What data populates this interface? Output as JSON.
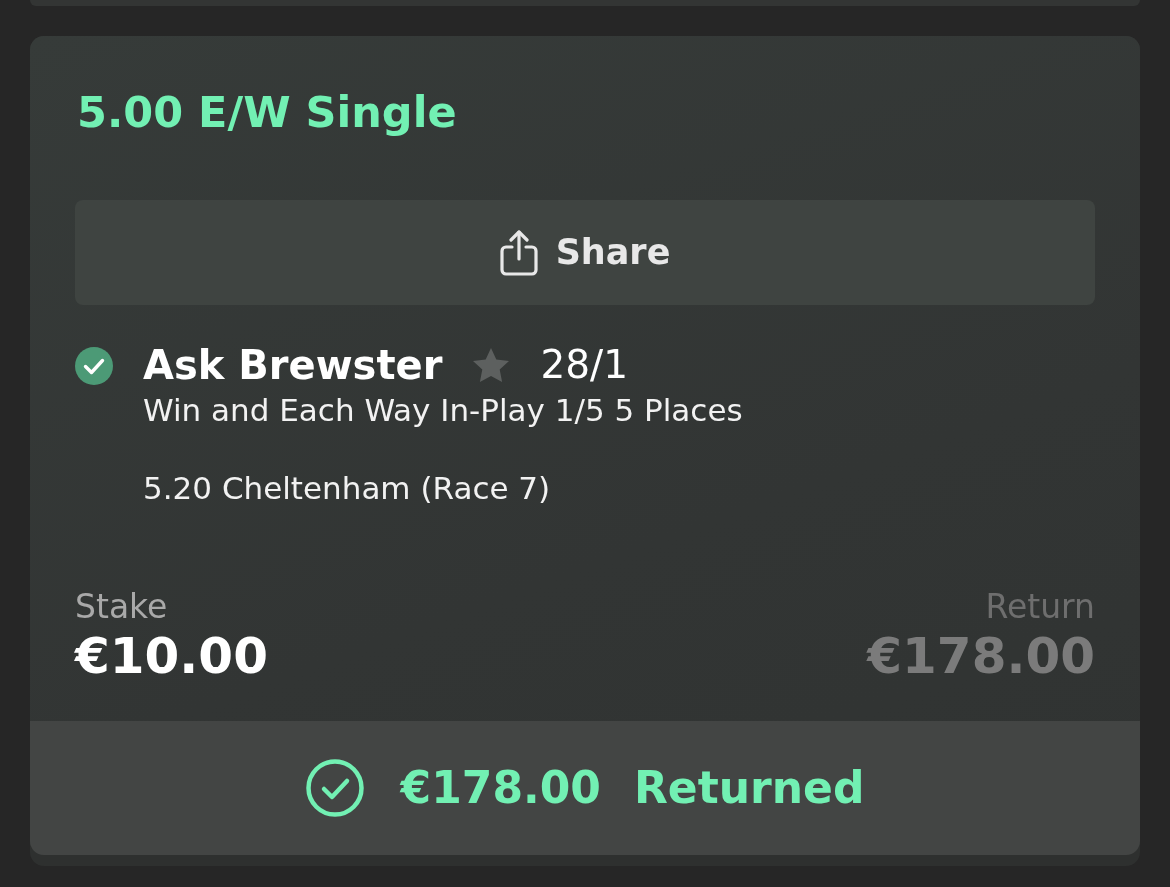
{
  "bet": {
    "title": "5.00 E/W Single",
    "share": {
      "label": "Share"
    },
    "selection": {
      "won": true,
      "name": "Ask Brewster",
      "starred": false,
      "odds": "28/1",
      "market": "Win and Each Way In-Play 1/5 5 Places",
      "event": "5.20 Cheltenham (Race 7)"
    },
    "stake": {
      "label": "Stake",
      "amount": "€10.00"
    },
    "return": {
      "label": "Return",
      "amount": "€178.00"
    },
    "result": {
      "amount": "€178.00",
      "label": "Returned"
    }
  }
}
